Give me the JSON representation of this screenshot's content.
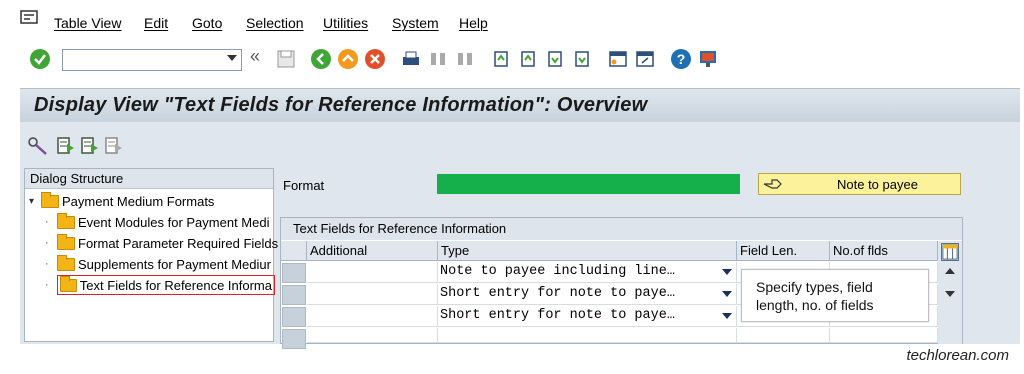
{
  "menu": {
    "items": [
      "Table View",
      "Edit",
      "Goto",
      "Selection",
      "Utilities",
      "System",
      "Help"
    ]
  },
  "toolbar": {
    "command_field": "",
    "icons": [
      "enter-icon",
      "back-double-icon",
      "save-icon",
      "back-icon",
      "exit-icon",
      "cancel-icon",
      "print-icon",
      "find-icon",
      "find-next-icon",
      "first-page-icon",
      "prev-page-icon",
      "next-page-icon",
      "last-page-icon",
      "new-session-icon",
      "shortcut-icon",
      "help-icon",
      "customize-layout-icon"
    ]
  },
  "title": "Display View \"Text Fields for Reference Information\": Overview",
  "dialog_structure": {
    "header": "Dialog Structure",
    "root": "Payment Medium Formats",
    "children": [
      "Event Modules for Payment Medi",
      "Format Parameter Required Fields",
      "Supplements for Payment Mediur",
      "Text Fields for Reference Informa"
    ]
  },
  "format": {
    "label": "Format",
    "value": "",
    "note_label": "Note to payee"
  },
  "table": {
    "title": "Text Fields for Reference Information",
    "columns": [
      "Additional",
      "Type",
      "Field Len.",
      "No.of flds"
    ],
    "rows": [
      {
        "additional": "",
        "type": "Note to payee including line…",
        "field_len": "",
        "no_flds": ""
      },
      {
        "additional": "",
        "type": "Short entry for note to paye…",
        "field_len": "",
        "no_flds": ""
      },
      {
        "additional": "",
        "type": "Short entry for note to paye…",
        "field_len": "",
        "no_flds": ""
      },
      {
        "additional": "",
        "type": "",
        "field_len": "",
        "no_flds": ""
      }
    ]
  },
  "callout": "Specify types, field length, no. of fields",
  "watermark": "techlorean.com",
  "colors": {
    "format_bar": "#15b04c",
    "note_box": "#fdf29c",
    "panel_bg": "#dfe6ed",
    "folder": "#f3b415"
  }
}
